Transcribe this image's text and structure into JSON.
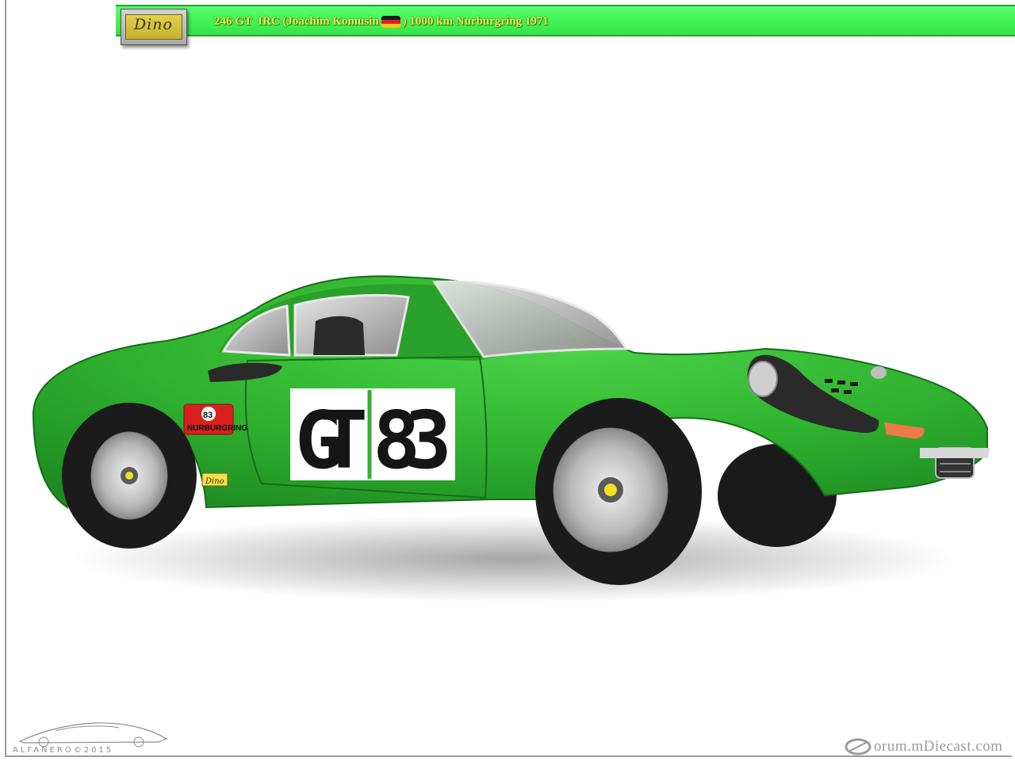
{
  "header": {
    "title_before_flag": "246 GT  IRC (Joachim Komusin",
    "title_after_flag": ") 1000 km Nurburgring 1971",
    "badge_text": "Dino",
    "flag_icon": "germany-flag-icon",
    "background_color": "#41f455",
    "title_color": "#e8f04a"
  },
  "car": {
    "number_decal": "GT83",
    "door_number_prefix": "GT",
    "door_number": "83",
    "rally_plate_number": "83",
    "rally_plate_text": "NURBURGRING",
    "rear_badge_text": "Dino",
    "body_color": "#2fb22f"
  },
  "watermarks": {
    "left_logo_text": "ALFANERO©2015",
    "right_text": "orum.mDiecast.com"
  }
}
